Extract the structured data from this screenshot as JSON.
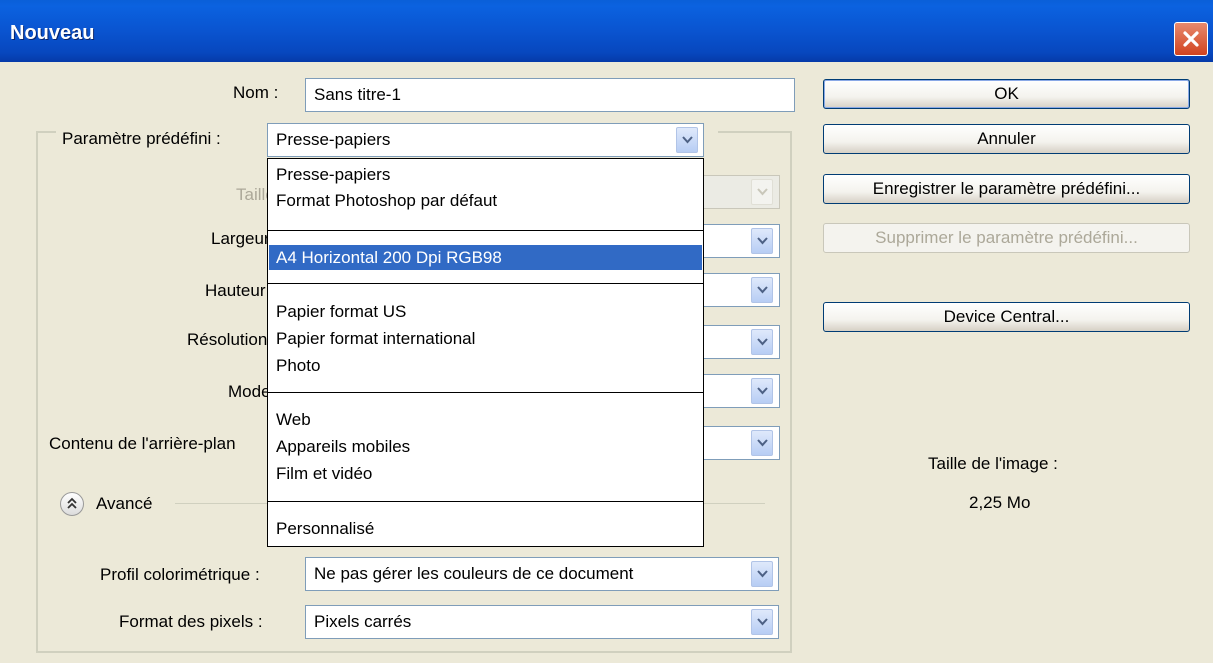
{
  "window": {
    "title": "Nouveau"
  },
  "name_field": {
    "label": "Nom :",
    "value": "Sans titre-1"
  },
  "preset": {
    "label": "Paramètre prédéfini :",
    "value": "Presse-papiers"
  },
  "size_label": "Taille",
  "width_label": "Largeur",
  "height_label": "Hauteur",
  "resolution_label": "Résolution",
  "mode_label": "Mode",
  "background_label": "Contenu de l'arrière-plan",
  "advanced": {
    "label": "Avancé"
  },
  "color_profile": {
    "label": "Profil colorimétrique :",
    "value": "Ne pas gérer les couleurs de ce document"
  },
  "pixel_format": {
    "label": "Format des pixels :",
    "value": "Pixels carrés"
  },
  "buttons": {
    "ok": "OK",
    "cancel": "Annuler",
    "save_preset": "Enregistrer le paramètre prédéfini...",
    "delete_preset": "Supprimer le paramètre prédéfini...",
    "device_central": "Device Central..."
  },
  "image_size": {
    "label": "Taille de l'image :",
    "value": "2,25 Mo"
  },
  "dropdown_items": {
    "clipboard": "Presse-papiers",
    "photoshop_default": "Format Photoshop par défaut",
    "a4": "A4 Horizontal 200 Dpi RGB98",
    "us_paper": "Papier format US",
    "intl_paper": "Papier format international",
    "photo": "Photo",
    "web": "Web",
    "mobile": "Appareils mobiles",
    "film": "Film et vidéo",
    "custom": "Personnalisé"
  },
  "colors": {
    "title_bar": "#0a54d0",
    "selection": "#316ac5",
    "dialog_bg": "#ece9d8"
  }
}
